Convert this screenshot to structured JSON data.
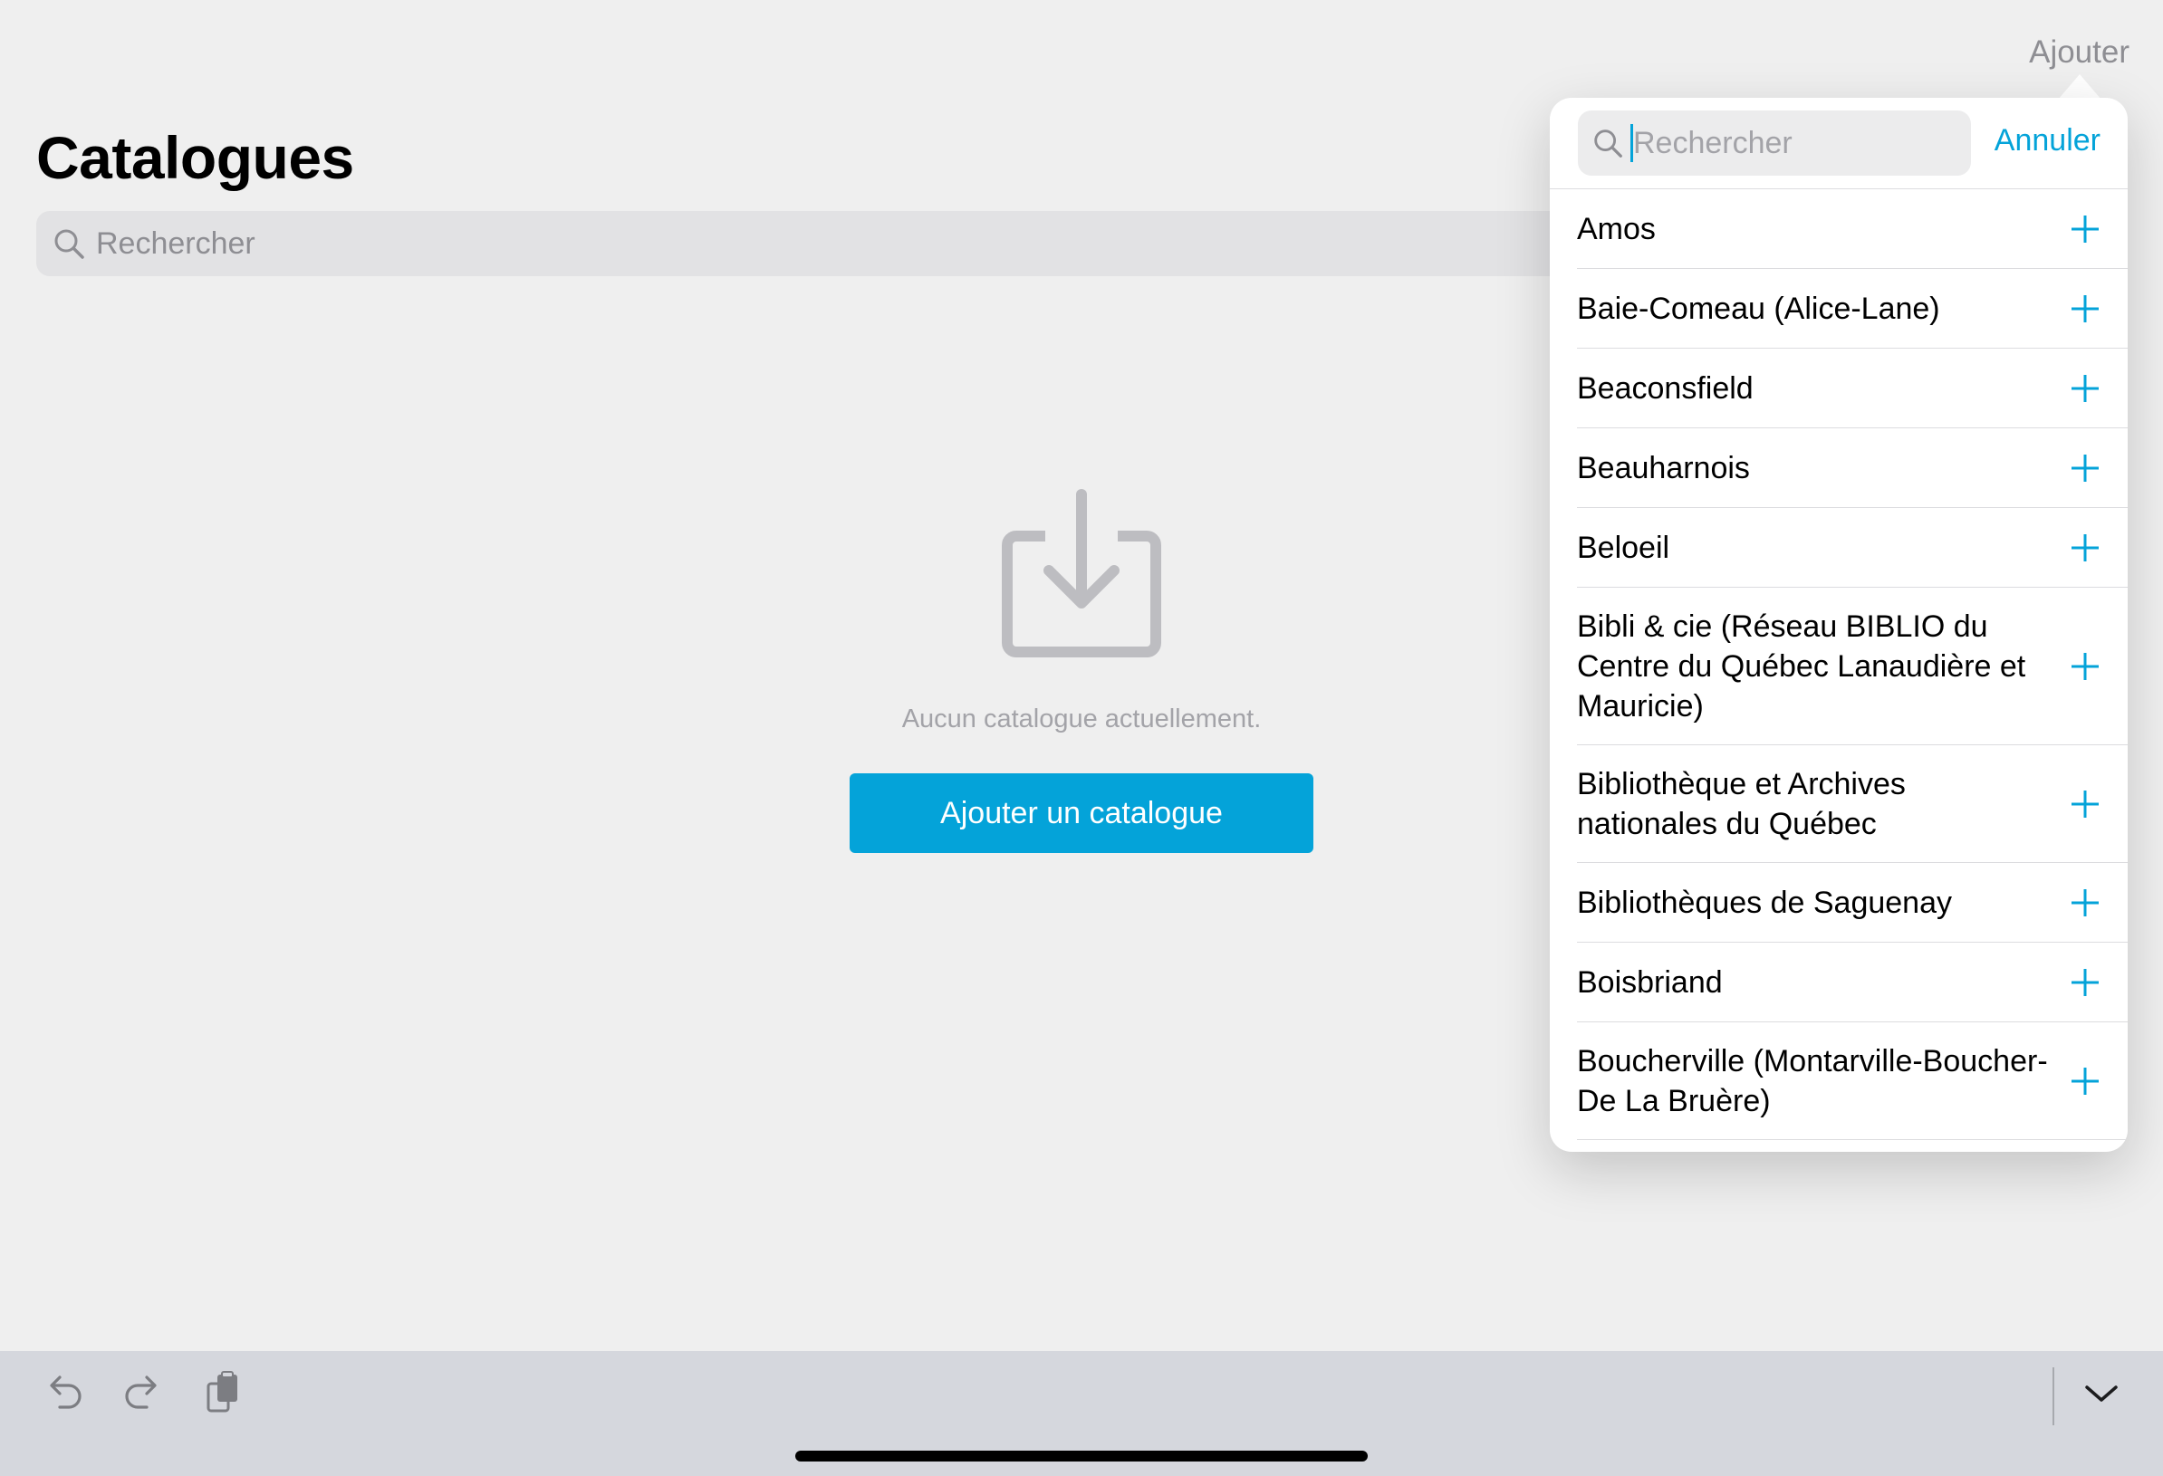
{
  "nav": {
    "add_label": "Ajouter"
  },
  "page": {
    "title": "Catalogues",
    "search_placeholder": "Rechercher",
    "empty_message": "Aucun catalogue actuellement.",
    "add_button_label": "Ajouter un catalogue"
  },
  "popover": {
    "search_placeholder": "Rechercher",
    "cancel_label": "Annuler",
    "items": [
      {
        "label": "Amos"
      },
      {
        "label": "Baie-Comeau (Alice-Lane)"
      },
      {
        "label": "Beaconsfield"
      },
      {
        "label": "Beauharnois"
      },
      {
        "label": "Beloeil"
      },
      {
        "label": "Bibli & cie (Réseau BIBLIO du Centre du Québec Lanaudière et Mauricie)"
      },
      {
        "label": "Bibliothèque et Archives nationales du Québec"
      },
      {
        "label": "Bibliothèques de Saguenay"
      },
      {
        "label": "Boisbriand"
      },
      {
        "label": "Boucherville (Montarville-Boucher-De La Bruère)"
      }
    ]
  },
  "toolbar": {
    "icons": [
      "undo-icon",
      "redo-icon",
      "clipboard-icon",
      "chevron-down-icon"
    ]
  },
  "colors": {
    "accent": "#04a3d9",
    "background": "#efefef",
    "toolbar": "#d5d7dd"
  }
}
